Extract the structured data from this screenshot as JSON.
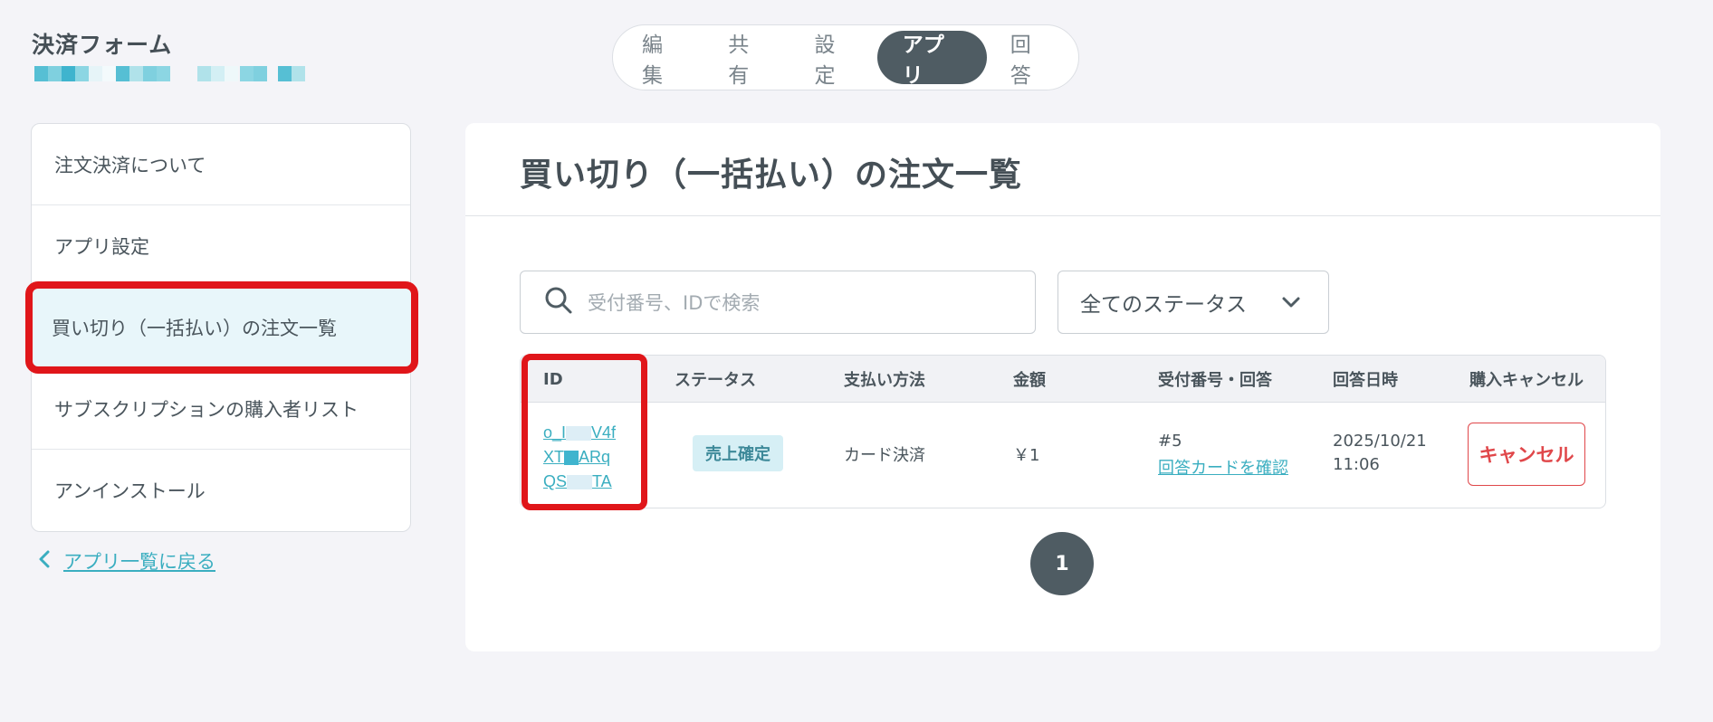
{
  "header": {
    "form_title": "決済フォーム",
    "tabs": [
      {
        "label": "編集",
        "active": false
      },
      {
        "label": "共有",
        "active": false
      },
      {
        "label": "設定",
        "active": false
      },
      {
        "label": "アプリ",
        "active": true
      },
      {
        "label": "回答",
        "active": false
      }
    ]
  },
  "sidebar": {
    "items": [
      {
        "label": "注文決済について",
        "active": false
      },
      {
        "label": "アプリ設定",
        "active": false
      },
      {
        "label": "買い切り（一括払い）の注文一覧",
        "active": true
      },
      {
        "label": "サブスクリプションの購入者リスト",
        "active": false
      },
      {
        "label": "アンインストール",
        "active": false
      }
    ],
    "back_link": "アプリ一覧に戻る"
  },
  "main": {
    "title": "買い切り（一括払い）の注文一覧",
    "search_placeholder": "受付番号、IDで検索",
    "status_filter": "全てのステータス",
    "table": {
      "headers": [
        "ID",
        "ステータス",
        "支払い方法",
        "金額",
        "受付番号・回答",
        "回答日時",
        "購入キャンセル"
      ],
      "rows": [
        {
          "id_lines": [
            "o_I",
            "V4f",
            "XT",
            "ARq",
            "QS",
            "TA"
          ],
          "status": "売上確定",
          "payment_method": "カード決済",
          "amount": "￥1",
          "receipt_no": "#5",
          "answer_link": "回答カードを確認",
          "date": "2025/10/21",
          "time": "11:06",
          "cancel_label": "キャンセル"
        }
      ]
    },
    "pagination": {
      "current": "1"
    }
  },
  "colors": {
    "accent": "#3aaec0",
    "dark_tab": "#4f5c63",
    "highlight": "#e0161a",
    "cancel": "#e0474a"
  }
}
